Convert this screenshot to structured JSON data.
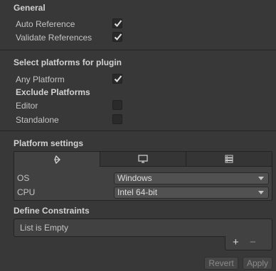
{
  "general": {
    "title": "General",
    "items": [
      {
        "label": "Auto Reference",
        "checked": true
      },
      {
        "label": "Validate References",
        "checked": true
      }
    ]
  },
  "platforms": {
    "title": "Select platforms for plugin",
    "any_platform": {
      "label": "Any Platform",
      "checked": true
    },
    "exclude_title": "Exclude Platforms",
    "exclude": [
      {
        "label": "Editor",
        "checked": false
      },
      {
        "label": "Standalone",
        "checked": false
      }
    ]
  },
  "platform_settings": {
    "title": "Platform settings",
    "tabs": [
      {
        "icon": "unity-logo-icon",
        "active": true
      },
      {
        "icon": "monitor-icon",
        "active": false
      },
      {
        "icon": "server-icon",
        "active": false
      }
    ],
    "os": {
      "label": "OS",
      "value": "Windows"
    },
    "cpu": {
      "label": "CPU",
      "value": "Intel 64-bit"
    }
  },
  "constraints": {
    "title": "Define Constraints",
    "empty_text": "List is Empty",
    "add_symbol": "+",
    "remove_symbol": "−"
  },
  "footer": {
    "revert_label": "Revert",
    "apply_label": "Apply"
  }
}
